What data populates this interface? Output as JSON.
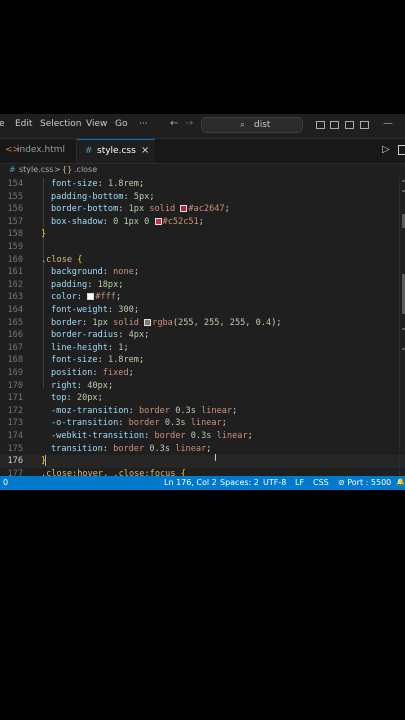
{
  "titlebar": {
    "menus": [
      "e",
      "Edit",
      "Selection",
      "View",
      "Go",
      "···"
    ],
    "search_text": "dist"
  },
  "tabs": [
    {
      "label": "index.html",
      "icon": "<>"
    },
    {
      "label": "style.css",
      "icon": "#",
      "close": "×"
    }
  ],
  "breadcrumb": {
    "file": "style.css",
    "sep": ">",
    "symbol_icon": "{}",
    "symbol": ".close"
  },
  "code": {
    "current_line": 176,
    "lines": [
      {
        "n": 154,
        "parts": [
          [
            "p",
            "font-size"
          ],
          [
            "pu",
            ": "
          ],
          [
            "n",
            "1.8rem"
          ],
          [
            "pu",
            ";"
          ]
        ],
        "indent": 1
      },
      {
        "n": 155,
        "parts": [
          [
            "p",
            "padding-bottom"
          ],
          [
            "pu",
            ": "
          ],
          [
            "n",
            "5px"
          ],
          [
            "pu",
            ";"
          ]
        ],
        "indent": 1
      },
      {
        "n": 156,
        "parts": [
          [
            "p",
            "border-bottom"
          ],
          [
            "pu",
            ": "
          ],
          [
            "n",
            "1px"
          ],
          [
            "v",
            " solid "
          ],
          [
            "sw",
            "#ac2647"
          ],
          [
            "v",
            "#ac2647"
          ],
          [
            "pu",
            ";"
          ]
        ],
        "indent": 1
      },
      {
        "n": 157,
        "parts": [
          [
            "p",
            "box-shadow"
          ],
          [
            "pu",
            ": "
          ],
          [
            "n",
            "0 1px 0 "
          ],
          [
            "sw",
            "#c52c51"
          ],
          [
            "v",
            "#c52c51"
          ],
          [
            "pu",
            ";"
          ]
        ],
        "indent": 1
      },
      {
        "n": 158,
        "parts": [
          [
            "b",
            "}"
          ]
        ],
        "indent": 0
      },
      {
        "n": 159,
        "parts": [],
        "indent": 0
      },
      {
        "n": 160,
        "parts": [
          [
            "s",
            ".close "
          ],
          [
            "b",
            "{"
          ]
        ],
        "indent": 0
      },
      {
        "n": 161,
        "parts": [
          [
            "p",
            "background"
          ],
          [
            "pu",
            ": "
          ],
          [
            "v",
            "none"
          ],
          [
            "pu",
            ";"
          ]
        ],
        "indent": 1
      },
      {
        "n": 162,
        "parts": [
          [
            "p",
            "padding"
          ],
          [
            "pu",
            ": "
          ],
          [
            "n",
            "18px"
          ],
          [
            "pu",
            ";"
          ]
        ],
        "indent": 1
      },
      {
        "n": 163,
        "parts": [
          [
            "p",
            "color"
          ],
          [
            "pu",
            ": "
          ],
          [
            "sw",
            "#ffffff"
          ],
          [
            "v",
            "#fff"
          ],
          [
            "pu",
            ";"
          ]
        ],
        "indent": 1
      },
      {
        "n": 164,
        "parts": [
          [
            "p",
            "font-weight"
          ],
          [
            "pu",
            ": "
          ],
          [
            "n",
            "300"
          ],
          [
            "pu",
            ";"
          ]
        ],
        "indent": 1
      },
      {
        "n": 165,
        "parts": [
          [
            "p",
            "border"
          ],
          [
            "pu",
            ": "
          ],
          [
            "n",
            "1px"
          ],
          [
            "v",
            " solid "
          ],
          [
            "sw",
            "#777777"
          ],
          [
            "v",
            "rgba"
          ],
          [
            "pu",
            "("
          ],
          [
            "n",
            "255, 255, 255, 0.4"
          ],
          [
            "pu",
            ");"
          ]
        ],
        "indent": 1
      },
      {
        "n": 166,
        "parts": [
          [
            "p",
            "border-radius"
          ],
          [
            "pu",
            ": "
          ],
          [
            "n",
            "4px"
          ],
          [
            "pu",
            ";"
          ]
        ],
        "indent": 1
      },
      {
        "n": 167,
        "parts": [
          [
            "p",
            "line-height"
          ],
          [
            "pu",
            ": "
          ],
          [
            "n",
            "1"
          ],
          [
            "pu",
            ";"
          ]
        ],
        "indent": 1
      },
      {
        "n": 168,
        "parts": [
          [
            "p",
            "font-size"
          ],
          [
            "pu",
            ": "
          ],
          [
            "n",
            "1.8rem"
          ],
          [
            "pu",
            ";"
          ]
        ],
        "indent": 1
      },
      {
        "n": 169,
        "parts": [
          [
            "p",
            "position"
          ],
          [
            "pu",
            ": "
          ],
          [
            "v",
            "fixed"
          ],
          [
            "pu",
            ";"
          ]
        ],
        "indent": 1
      },
      {
        "n": 170,
        "parts": [
          [
            "p",
            "right"
          ],
          [
            "pu",
            ": "
          ],
          [
            "n",
            "40px"
          ],
          [
            "pu",
            ";"
          ]
        ],
        "indent": 1
      },
      {
        "n": 171,
        "parts": [
          [
            "p",
            "top"
          ],
          [
            "pu",
            ": "
          ],
          [
            "n",
            "20px"
          ],
          [
            "pu",
            ";"
          ]
        ],
        "indent": 1
      },
      {
        "n": 172,
        "parts": [
          [
            "p",
            "-moz-transition"
          ],
          [
            "pu",
            ": "
          ],
          [
            "v",
            "border "
          ],
          [
            "n",
            "0.3s"
          ],
          [
            "v",
            " linear"
          ],
          [
            "pu",
            ";"
          ]
        ],
        "indent": 1
      },
      {
        "n": 173,
        "parts": [
          [
            "p",
            "-o-transition"
          ],
          [
            "pu",
            ": "
          ],
          [
            "v",
            "border "
          ],
          [
            "n",
            "0.3s"
          ],
          [
            "v",
            " linear"
          ],
          [
            "pu",
            ";"
          ]
        ],
        "indent": 1
      },
      {
        "n": 174,
        "parts": [
          [
            "p",
            "-webkit-transition"
          ],
          [
            "pu",
            ": "
          ],
          [
            "v",
            "border "
          ],
          [
            "n",
            "0.3s"
          ],
          [
            "v",
            " linear"
          ],
          [
            "pu",
            ";"
          ]
        ],
        "indent": 1
      },
      {
        "n": 175,
        "parts": [
          [
            "p",
            "transition"
          ],
          [
            "pu",
            ": "
          ],
          [
            "v",
            "border "
          ],
          [
            "n",
            "0.3s"
          ],
          [
            "v",
            " linear"
          ],
          [
            "pu",
            ";"
          ]
        ],
        "indent": 1
      },
      {
        "n": 176,
        "parts": [
          [
            "b",
            "}"
          ]
        ],
        "indent": 0
      },
      {
        "n": 177,
        "parts": [
          [
            "s",
            ".close:hover, .close:focus "
          ],
          [
            "b",
            "{"
          ]
        ],
        "indent": 0
      }
    ]
  },
  "statusbar": {
    "left": "0",
    "position": "Ln 176, Col 2",
    "spaces": "Spaces: 2",
    "encoding": "UTF-8",
    "eol": "LF",
    "language": "CSS",
    "port": "⊘ Port : 5500",
    "bell": "🔔"
  },
  "colors": {
    "accent": "#007acc",
    "editor_bg": "#1f1f1f",
    "property": "#9cdcfe",
    "value": "#ce9178",
    "number": "#b5cea8",
    "selector": "#d7ba7d"
  }
}
